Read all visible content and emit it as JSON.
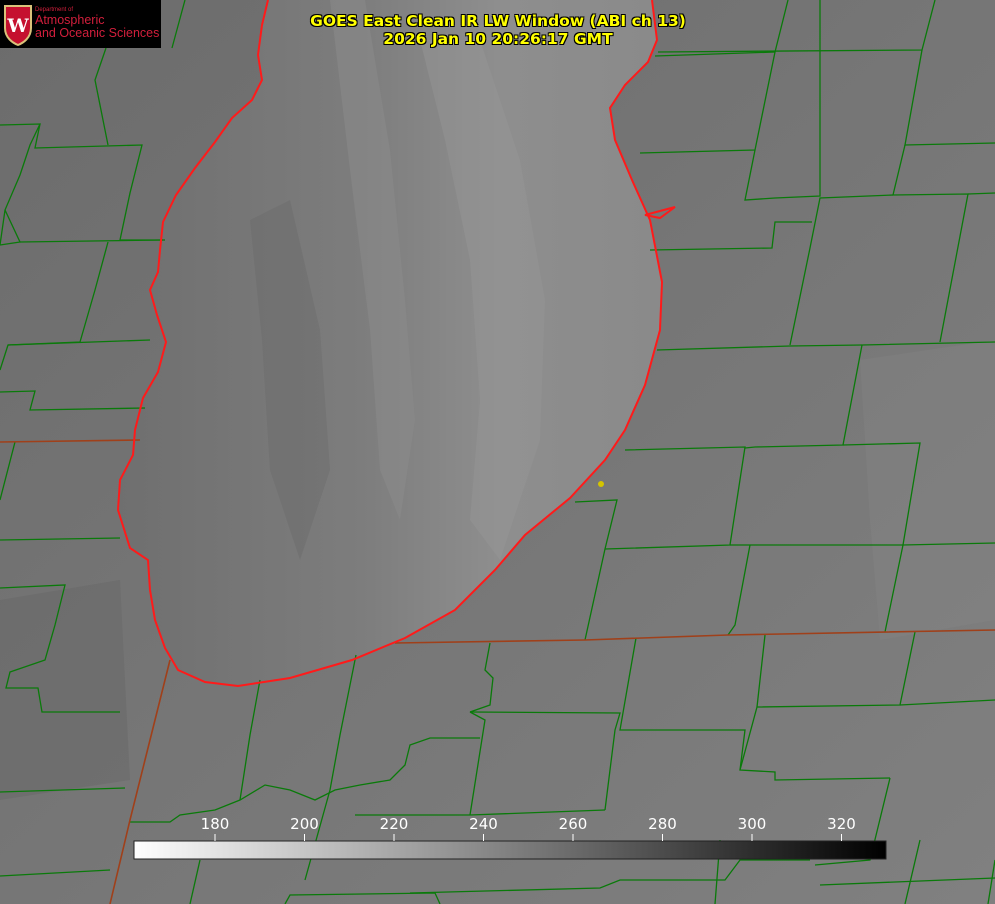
{
  "logo": {
    "department": "Department of",
    "line1": "Atmospheric",
    "line2": "and Oceanic Sciences",
    "seal_letter": "W",
    "color": "#d21f3c"
  },
  "title": {
    "line1": "GOES East Clean IR LW Window (ABI ch 13)",
    "line2": "2026 Jan 10 20:26:17 GMT",
    "color": "#ffff00"
  },
  "colorbar": {
    "tick_labels": [
      "180",
      "200",
      "220",
      "240",
      "260",
      "280",
      "300",
      "320"
    ],
    "scale_start": "white",
    "scale_end": "black"
  },
  "map_overlay": {
    "county_line_color": "#0a7a0a",
    "state_line_color": "#a0401a",
    "shoreline_color": "#ff1a1a",
    "marker_color": "#d4c400"
  }
}
